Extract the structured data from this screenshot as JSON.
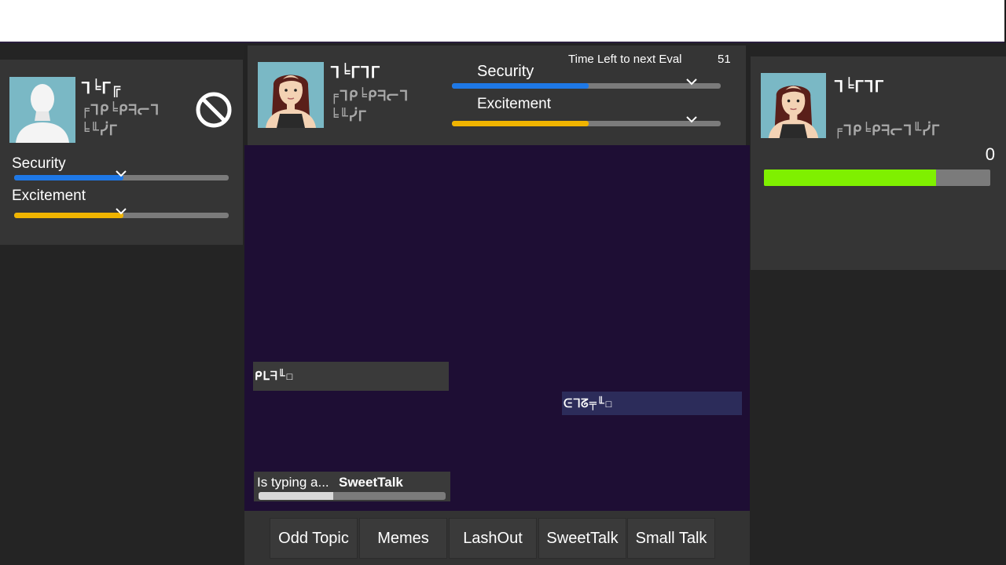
{
  "left_profile": {
    "avatar": "silhouette-avatar",
    "name": "ᒣ╘ᒥ╔",
    "bio_line1": "╒ᒣᑭ╘ᑭᖷᓕᒣ",
    "bio_line2": "╘╙ᓰᒥ",
    "block_icon": "block-icon",
    "stats": [
      {
        "label": "Security",
        "value": 0.51,
        "color": "#1e78e6"
      },
      {
        "label": "Excitement",
        "value": 0.51,
        "color": "#f0b400"
      }
    ]
  },
  "center": {
    "avatar": "girl-avatar",
    "name": "ᒣ╘ᒥᒣᒥ",
    "bio_line1": "╒ᒣᑭ╘ᑭᖷᓕᒣ",
    "bio_line2": "╘╙ᓰᒥ",
    "timer_label": "Time Left to next Eval",
    "timer_value": "51",
    "stats": [
      {
        "label": "Security",
        "value": 0.51,
        "color": "#1e78e6"
      },
      {
        "label": "Excitement",
        "value": 0.51,
        "color": "#f0b400"
      }
    ]
  },
  "chat": {
    "messages": [
      {
        "text": "ᑭᒪᖷ╙☐",
        "side": "left"
      },
      {
        "text": "ᕮᒣᘔ╤╙☐",
        "side": "right"
      }
    ],
    "typing_prefix": "Is typing a...",
    "typing_action": "SweetTalk",
    "typing_progress": 0.4
  },
  "actions": [
    "Odd Topic",
    "Memes",
    "LashOut",
    "SweetTalk",
    "Small Talk"
  ],
  "right_profile": {
    "avatar": "girl-avatar",
    "name": "ᒣ╘ᒥᒣᒥ",
    "bio_line1": "╒ᒣᑭ╘ᑭᖷᓕᒣ╙ᓰᒥ",
    "score": "0",
    "progress": 0.76,
    "progress_color": "#7ff000"
  }
}
